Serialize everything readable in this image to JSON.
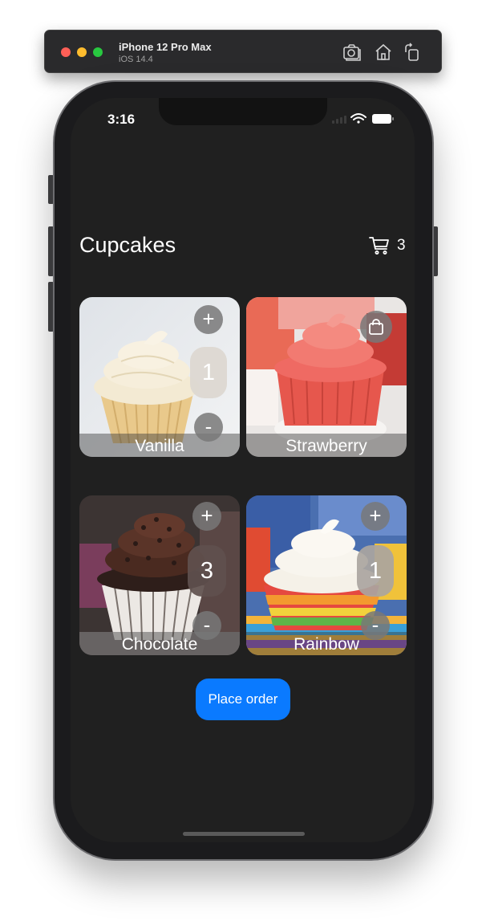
{
  "simulator": {
    "device_name": "iPhone 12 Pro Max",
    "os_version": "iOS 14.4",
    "icons": [
      "screenshot-icon",
      "home-icon",
      "rotate-icon"
    ]
  },
  "status_bar": {
    "time": "3:16"
  },
  "app": {
    "title": "Cupcakes",
    "cart_count": "3",
    "cart_icon": "cart-icon",
    "place_order_label": "Place order",
    "accent_color": "#0a7aff"
  },
  "cupcakes": [
    {
      "name": "Vanilla",
      "quantity": "1",
      "plus": "+",
      "minus": "-"
    },
    {
      "name": "Strawberry",
      "quantity": "",
      "bag_icon": "shopping-bag-icon"
    },
    {
      "name": "Chocolate",
      "quantity": "3",
      "plus": "+",
      "minus": "-"
    },
    {
      "name": "Rainbow",
      "quantity": "1",
      "plus": "+",
      "minus": "-"
    }
  ]
}
